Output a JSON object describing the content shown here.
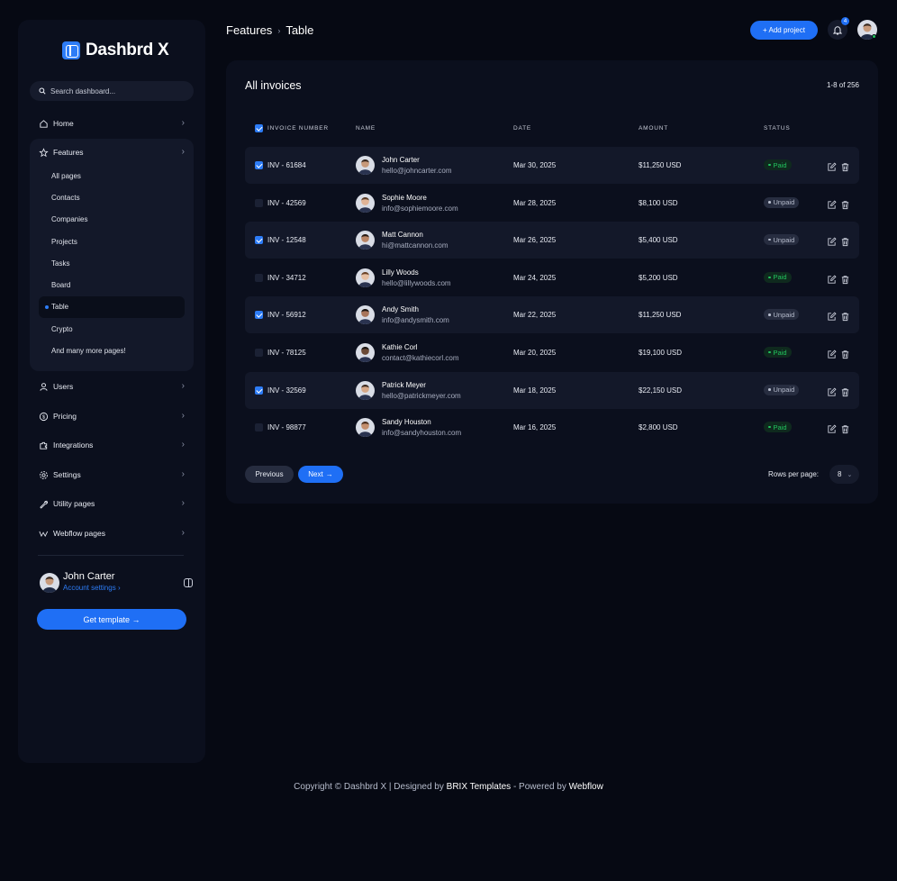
{
  "app": {
    "logo_text": "Dashbrd X",
    "brand_color": "#2d7cf6"
  },
  "search": {
    "placeholder": "Search dashboard..."
  },
  "sidebar": {
    "items": [
      {
        "label": "Home",
        "icon": "home-icon"
      },
      {
        "label": "Features",
        "icon": "star-icon",
        "expanded": true
      },
      {
        "label": "Users",
        "icon": "user-icon"
      },
      {
        "label": "Pricing",
        "icon": "dollar-icon"
      },
      {
        "label": "Integrations",
        "icon": "puzzle-icon"
      },
      {
        "label": "Settings",
        "icon": "gear-icon"
      },
      {
        "label": "Utility pages",
        "icon": "wrench-icon"
      },
      {
        "label": "Webflow pages",
        "icon": "webflow-icon"
      }
    ],
    "features_sub": [
      "All pages",
      "Contacts",
      "Companies",
      "Projects",
      "Tasks",
      "Board",
      "Table",
      "Crypto",
      "And many more pages!"
    ],
    "active_sub": "Table"
  },
  "user": {
    "name": "John Carter",
    "account_link": "Account settings"
  },
  "get_template": "Get template",
  "header": {
    "breadcrumb_parent": "Features",
    "breadcrumb_current": "Table",
    "add_project": "+ Add project",
    "notifications_count": "4"
  },
  "invoices": {
    "title": "All invoices",
    "range": "1-8 of 256",
    "columns": [
      "INVOICE NUMBER",
      "NAME",
      "DATE",
      "AMOUNT",
      "STATUS"
    ],
    "rows": [
      {
        "checked": true,
        "number": "INV - 61684",
        "name": "John Carter",
        "email": "hello@johncarter.com",
        "date": "Mar 30, 2025",
        "amount": "$11,250 USD",
        "status": "Paid"
      },
      {
        "checked": false,
        "number": "INV - 42569",
        "name": "Sophie Moore",
        "email": "info@sophiemoore.com",
        "date": "Mar 28, 2025",
        "amount": "$8,100 USD",
        "status": "Unpaid"
      },
      {
        "checked": true,
        "number": "INV - 12548",
        "name": "Matt Cannon",
        "email": "hi@mattcannon.com",
        "date": "Mar 26, 2025",
        "amount": "$5,400 USD",
        "status": "Unpaid"
      },
      {
        "checked": false,
        "number": "INV - 34712",
        "name": "Lilly Woods",
        "email": "hello@lillywoods.com",
        "date": "Mar 24, 2025",
        "amount": "$5,200 USD",
        "status": "Paid"
      },
      {
        "checked": true,
        "number": "INV - 56912",
        "name": "Andy Smith",
        "email": "info@andysmith.com",
        "date": "Mar 22, 2025",
        "amount": "$11,250 USD",
        "status": "Unpaid"
      },
      {
        "checked": false,
        "number": "INV - 78125",
        "name": "Kathie Corl",
        "email": "contact@kathiecorl.com",
        "date": "Mar 20, 2025",
        "amount": "$19,100 USD",
        "status": "Paid"
      },
      {
        "checked": true,
        "number": "INV - 32569",
        "name": "Patrick Meyer",
        "email": "hello@patrickmeyer.com",
        "date": "Mar 18, 2025",
        "amount": "$22,150 USD",
        "status": "Unpaid"
      },
      {
        "checked": false,
        "number": "INV - 98877",
        "name": "Sandy Houston",
        "email": "info@sandyhouston.com",
        "date": "Mar 16, 2025",
        "amount": "$2,800 USD",
        "status": "Paid"
      }
    ]
  },
  "pagination": {
    "previous": "Previous",
    "next": "Next",
    "rows_per_page_label": "Rows per page:",
    "rows_per_page_value": "8"
  },
  "footer": {
    "prefix": "Copyright © Dashbrd X | Designed by ",
    "brix": "BRIX Templates",
    "middle": " - Powered by ",
    "webflow": "Webflow"
  }
}
